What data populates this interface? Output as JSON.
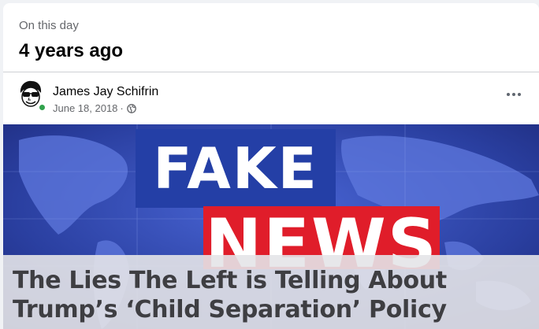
{
  "memory": {
    "label": "On this day",
    "title": "4 years ago"
  },
  "post": {
    "author": "James Jay Schifrin",
    "date": "June 18, 2018",
    "separator": "·",
    "privacy_icon": "globe-icon",
    "more_icon": "more-options-icon",
    "online": true
  },
  "link_preview": {
    "image_text_top": "FAKE",
    "image_text_bottom": "NEWS",
    "headline": "The Lies The Left is Telling About Trump’s ‘Child Separation’ Policy"
  },
  "colors": {
    "online_dot": "#31a24c",
    "fake_box": "#243fa6",
    "news_box": "#e01d2a",
    "map_background": "#2a3fa0"
  }
}
